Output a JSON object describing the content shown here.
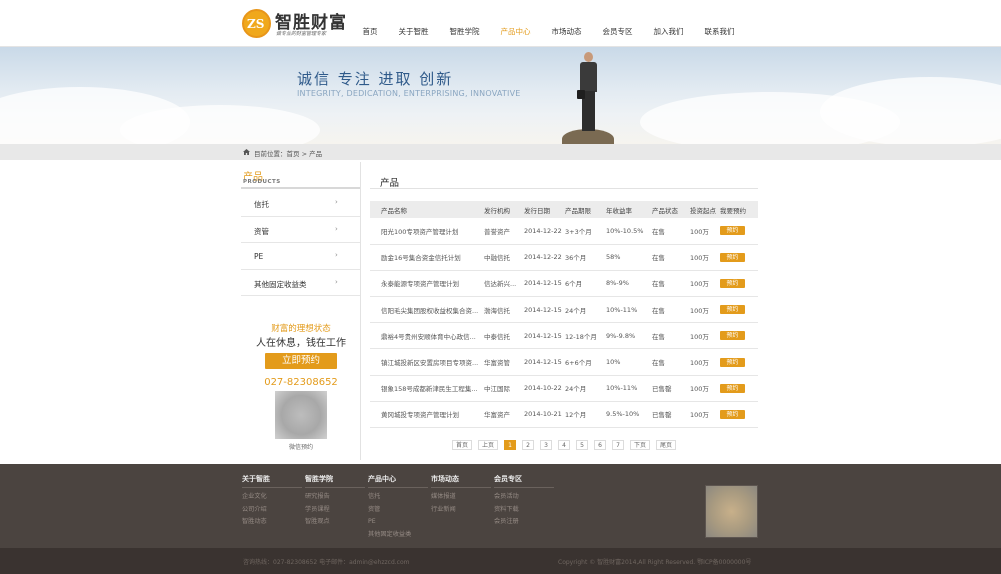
{
  "logo": {
    "mark": "ZS",
    "name": "智胜财富",
    "slogan": "做专业的财富管理专家"
  },
  "nav": [
    "首页",
    "关于智胜",
    "智胜学院",
    "产品中心",
    "市场动态",
    "会员专区",
    "加入我们",
    "联系我们"
  ],
  "nav_active": 3,
  "banner": {
    "title": "诚信  专注  进取  创新",
    "subtitle": "INTEGRITY, DEDICATION, ENTERPRISING, INNOVATIVE"
  },
  "breadcrumb": "目前位置：首页 > 产品",
  "sidebar": {
    "title": "产品",
    "subtitle": "PRODUCTS",
    "items": [
      {
        "label": "信托",
        "arrow": "›"
      },
      {
        "label": "资管",
        "arrow": "›"
      },
      {
        "label": "PE",
        "arrow": "›"
      },
      {
        "label": "其他固定收益类",
        "arrow": "›"
      }
    ],
    "promo_line1": "财富的理想状态",
    "promo_line2": "人在休息，钱在工作",
    "promo_button": "立即预约",
    "phone": "027-82308652",
    "qr_caption": "微信预约"
  },
  "main": {
    "title": "产品",
    "columns": [
      "产品名称",
      "发行机构",
      "发行日期",
      "产品期限",
      "年收益率",
      "产品状态",
      "投资起点",
      "我要预约"
    ],
    "rows": [
      [
        "阳光100专项资产管理计划",
        "普誉资产",
        "2014-12-22",
        "3+3个月",
        "10%-10.5%",
        "在售",
        "100万",
        "预约"
      ],
      [
        "励金16号集合资金信托计划",
        "中融信托",
        "2014-12-22",
        "36个月",
        "58%",
        "在售",
        "100万",
        "预约"
      ],
      [
        "永泰能源专项资产管理计划",
        "信达新兴...",
        "2014-12-15",
        "6个月",
        "8%-9%",
        "在售",
        "100万",
        "预约"
      ],
      [
        "信阳毛尖集团股权收益权集合资...",
        "渤海信托",
        "2014-12-15",
        "24个月",
        "10%-11%",
        "在售",
        "100万",
        "预约"
      ],
      [
        "鼎裕4号贵州安顺体育中心政信...",
        "中泰信托",
        "2014-12-15",
        "12-18个月",
        "9%-9.8%",
        "在售",
        "100万",
        "预约"
      ],
      [
        "镇江城投新区安置房项目专项资...",
        "华富资管",
        "2014-12-15",
        "6+6个月",
        "10%",
        "在售",
        "100万",
        "预约"
      ],
      [
        "银象158号成都新津民生工程集...",
        "中江国际",
        "2014-10-22",
        "24个月",
        "10%-11%",
        "已售罄",
        "100万",
        "预约"
      ],
      [
        "黄冈城投专项资产管理计划",
        "华富资产",
        "2014-10-21",
        "12个月",
        "9.5%-10%",
        "已售罄",
        "100万",
        "预约"
      ]
    ]
  },
  "pager": {
    "first": "首页",
    "prev": "上页",
    "pages": [
      "1",
      "2",
      "3",
      "4",
      "5",
      "6",
      "7"
    ],
    "current": 0,
    "next": "下页",
    "last": "尾页"
  },
  "footer": {
    "columns": [
      {
        "title": "关于智胜",
        "items": [
          "企业文化",
          "公司介绍",
          "智胜动态"
        ]
      },
      {
        "title": "智胜学院",
        "items": [
          "研究报告",
          "学员课程",
          "智胜观点"
        ]
      },
      {
        "title": "产品中心",
        "items": [
          "信托",
          "资管",
          "PE",
          "其他固定收益类"
        ]
      },
      {
        "title": "市场动态",
        "items": [
          "媒体报道",
          "行业新闻"
        ]
      },
      {
        "title": "会员专区",
        "items": [
          "会员活动",
          "资料下载",
          "会员注册"
        ]
      }
    ],
    "bottom_left": "咨询热线：027-82308652  电子邮件：admin@ehzzcd.com",
    "bottom_right": "Copyright © 智胜财富2014,All Right Reserved.  鄂ICP备0000000号"
  },
  "colors": {
    "accent": "#e39b1b",
    "footer": "#4b4440",
    "bottom": "#3a3330"
  }
}
